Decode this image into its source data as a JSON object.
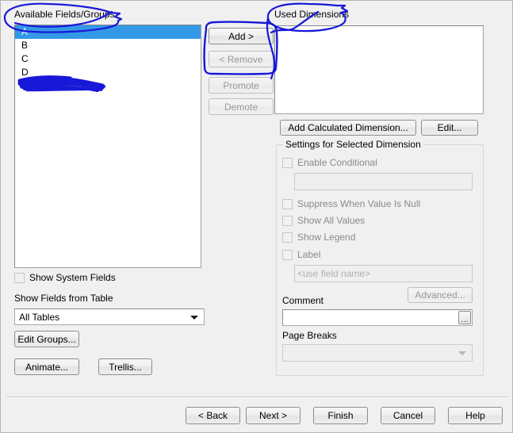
{
  "dialog": {
    "title": "Dimensions wizard page",
    "available_fields": {
      "label": "Available Fields/Groups",
      "items": [
        {
          "text": "A",
          "selected": true,
          "redacted": false
        },
        {
          "text": "B",
          "selected": false,
          "redacted": false
        },
        {
          "text": "C",
          "selected": false,
          "redacted": false
        },
        {
          "text": "D",
          "selected": false,
          "redacted": false
        },
        {
          "text": "",
          "selected": false,
          "redacted": true
        }
      ]
    },
    "used_dimensions": {
      "label": "Used Dimensions",
      "items": []
    },
    "transfer_buttons": [
      {
        "label": "Add >",
        "enabled": true
      },
      {
        "label": "< Remove",
        "enabled": false
      },
      {
        "label": "Promote",
        "enabled": false
      },
      {
        "label": "Demote",
        "enabled": false
      }
    ],
    "dimension_buttons": {
      "add_calculated": "Add Calculated Dimension...",
      "edit": "Edit..."
    },
    "settings": {
      "group_title": "Settings for Selected Dimension",
      "enable_conditional": {
        "label": "Enable Conditional",
        "checked": false,
        "enabled": false
      },
      "conditional_expression": {
        "value": "",
        "enabled": false
      },
      "suppress_when_null": {
        "label": "Suppress When Value Is Null",
        "checked": false,
        "enabled": false
      },
      "show_all_values": {
        "label": "Show All Values",
        "checked": false,
        "enabled": false
      },
      "show_legend": {
        "label": "Show Legend",
        "checked": false,
        "enabled": false
      },
      "label_checkbox": {
        "label": "Label",
        "checked": false,
        "enabled": false
      },
      "label_field": {
        "placeholder": "<use field name>",
        "value": "",
        "enabled": false
      },
      "advanced_button": {
        "label": "Advanced...",
        "enabled": false
      },
      "comment": {
        "label": "Comment",
        "value": "",
        "enabled": true
      },
      "comment_browse_button": {
        "label": "...",
        "enabled": true
      },
      "page_breaks": {
        "label": "Page Breaks",
        "value": "",
        "enabled": false
      }
    },
    "left_options": {
      "show_system_fields": {
        "label": "Show System Fields",
        "checked": false,
        "enabled": false
      },
      "show_fields_from_table_label": "Show Fields from Table",
      "table_filter": {
        "value": "All Tables",
        "enabled": true
      },
      "edit_groups_button": "Edit Groups...",
      "animate_button": "Animate...",
      "trellis_button": "Trellis..."
    },
    "footer_buttons": [
      {
        "label": "< Back",
        "enabled": true
      },
      {
        "label": "Next >",
        "enabled": true
      },
      {
        "label": "Finish",
        "enabled": true
      },
      {
        "label": "Cancel",
        "enabled": true
      },
      {
        "label": "Help",
        "enabled": true
      }
    ],
    "annotations": {
      "ink_color": "#1818d8",
      "marks": [
        {
          "name": "circle-available-fields-groups",
          "shape": "ellipse-with-tail"
        },
        {
          "name": "circle-used-dimensions",
          "shape": "ellipse-with-tail"
        },
        {
          "name": "box-add-remove-buttons",
          "shape": "rounded-rectangle"
        },
        {
          "name": "scribble-redacted-field",
          "shape": "scribble"
        }
      ]
    },
    "colors": {
      "window_background": "#f0f0f0",
      "selection_blue": "#3399e6",
      "ink_blue": "#1818d8",
      "field_white": "#ffffff",
      "disabled_text": "#9a9a9a"
    }
  }
}
